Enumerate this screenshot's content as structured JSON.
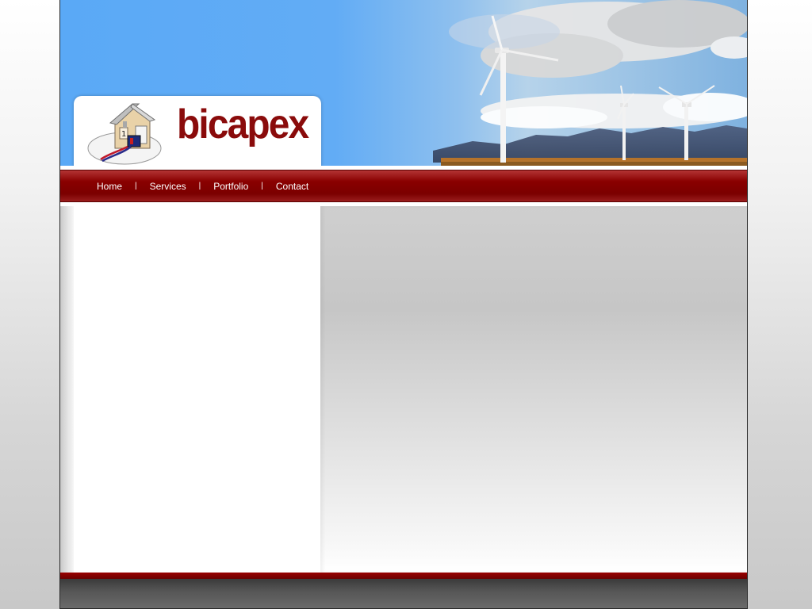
{
  "brand": {
    "name": "bicapex",
    "color": "#8a0b0b"
  },
  "nav": {
    "items": [
      {
        "label": "Home"
      },
      {
        "label": "Services"
      },
      {
        "label": "Portfolio"
      },
      {
        "label": "Contact"
      }
    ],
    "separator": "|",
    "color": "#8a0000"
  },
  "header": {
    "image": "wind-turbines-landscape",
    "sky_color": "#5aa9f6"
  },
  "footer": {
    "accent_color": "#8a0000"
  }
}
